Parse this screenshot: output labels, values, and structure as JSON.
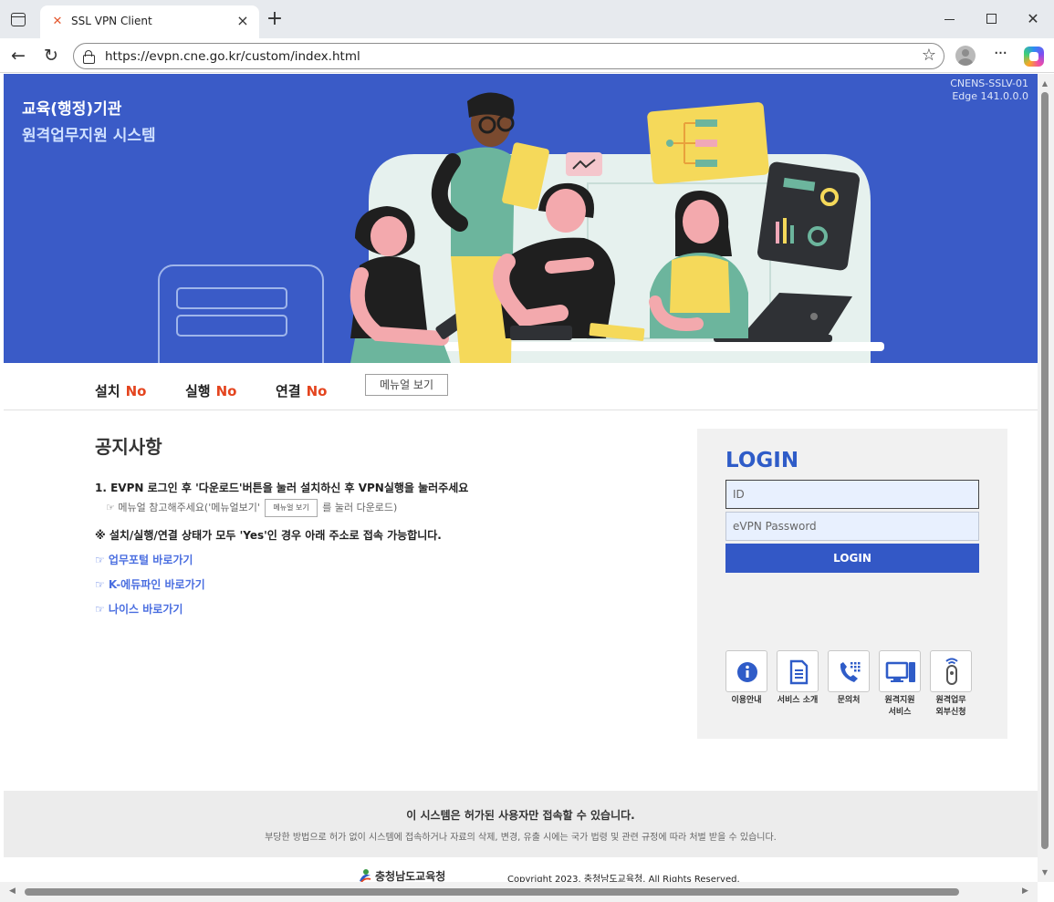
{
  "browser": {
    "tab_title": "SSL VPN Client",
    "url": "https://evpn.cne.go.kr/custom/index.html"
  },
  "banner": {
    "title_line1": "교육(행정)기관",
    "title_line2": "원격업무지원 시스템",
    "version_line1": "CNENS-SSLV-01",
    "version_line2": "Edge 141.0.0.0"
  },
  "status": {
    "install_label": "설치",
    "install_value": "No",
    "run_label": "실행",
    "run_value": "No",
    "connect_label": "연결",
    "connect_value": "No",
    "manual_button": "메뉴얼 보기"
  },
  "notice": {
    "title": "공지사항",
    "line1": "1. EVPN 로그인 후 '다운로드'버튼을 눌러 설치하신 후 VPN실행을 눌러주세요",
    "line2_prefix": "☞ 메뉴얼 참고해주세요('메뉴얼보기'",
    "line2_mini_button": "메뉴얼 보기",
    "line2_suffix": "를 눌러 다운로드)",
    "line3": "※ 설치/실행/연결 상태가 모두 'Yes'인 경우 아래 주소로 접속 가능합니다.",
    "links": [
      "☞ 업무포털 바로가기",
      "☞ K-에듀파인 바로가기",
      "☞ 나이스 바로가기"
    ]
  },
  "login": {
    "title": "LOGIN",
    "id_placeholder": "ID",
    "pw_placeholder": "eVPN Password",
    "button": "LOGIN",
    "quick_links": [
      {
        "label": "이용안내",
        "icon": "info-icon"
      },
      {
        "label": "서비스 소개",
        "icon": "document-icon"
      },
      {
        "label": "문의처",
        "icon": "phone-icon"
      },
      {
        "label": "원격지원\n서비스",
        "icon": "computer-icon"
      },
      {
        "label": "원격업무\n외부신청",
        "icon": "remote-icon"
      }
    ]
  },
  "footer": {
    "warning_title": "이 시스템은 허가된 사용자만 접속할 수 있습니다.",
    "warning_text": "부당한 방법으로 허가 없이 시스템에 접속하거나 자료의 삭제, 변경, 유출 시에는 국가 법령 및 관련 규정에 따라 처벌 받을 수 있습니다.",
    "org_name": "충청남도교육청",
    "copyright": "Copyright 2023. 충청남도교육청. All Rights Reserved."
  },
  "colors": {
    "banner_bg": "#3a5bc7",
    "status_no": "#e4451f",
    "login_accent": "#3358c6",
    "link": "#4a6ee0"
  }
}
